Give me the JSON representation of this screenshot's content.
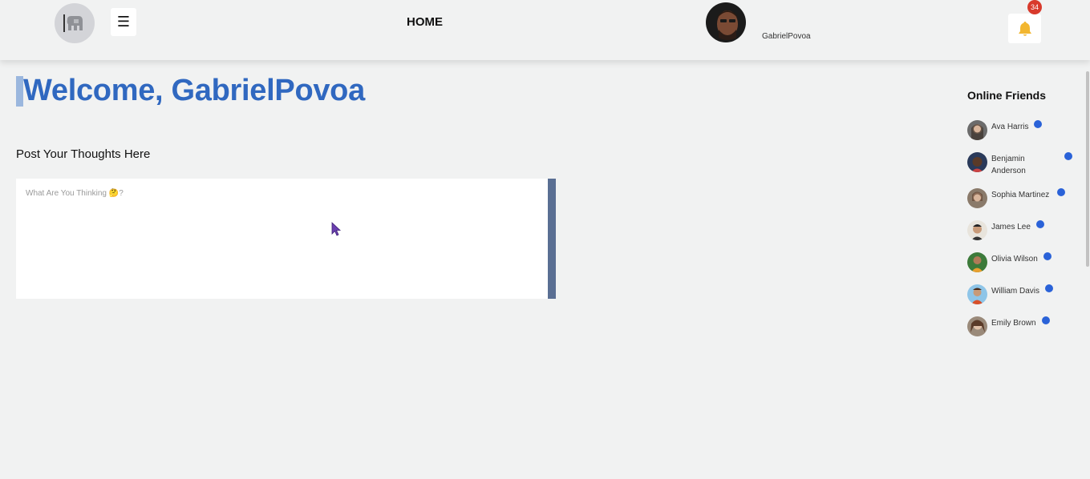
{
  "nav": {
    "home_label": "HOME",
    "username": "GabrielPovoa",
    "notification_count": "34",
    "menu_glyph": "☰"
  },
  "main": {
    "welcome": "Welcome, GabrielPovoa",
    "post_label": "Post Your Thoughts Here",
    "post_placeholder": "What Are You Thinking 🤔?"
  },
  "friends": {
    "title": "Online Friends",
    "items": [
      {
        "name": "Ava Harris",
        "status": "online"
      },
      {
        "name": "Benjamin Anderson",
        "status": "online"
      },
      {
        "name": "Sophia Martinez",
        "status": "online"
      },
      {
        "name": "James Lee",
        "status": "online"
      },
      {
        "name": "Olivia Wilson",
        "status": "online"
      },
      {
        "name": "William Davis",
        "status": "online"
      },
      {
        "name": "Emily Brown",
        "status": "online"
      }
    ]
  },
  "colors": {
    "accent": "#3068c0",
    "online": "#2a62d8",
    "badge": "#d83a2c",
    "bell": "#f2b630"
  },
  "icons": {
    "logo": "elephant-icon",
    "menu": "hamburger-menu-icon",
    "bell": "bell-icon",
    "cursor": "mouse-pointer-icon"
  }
}
